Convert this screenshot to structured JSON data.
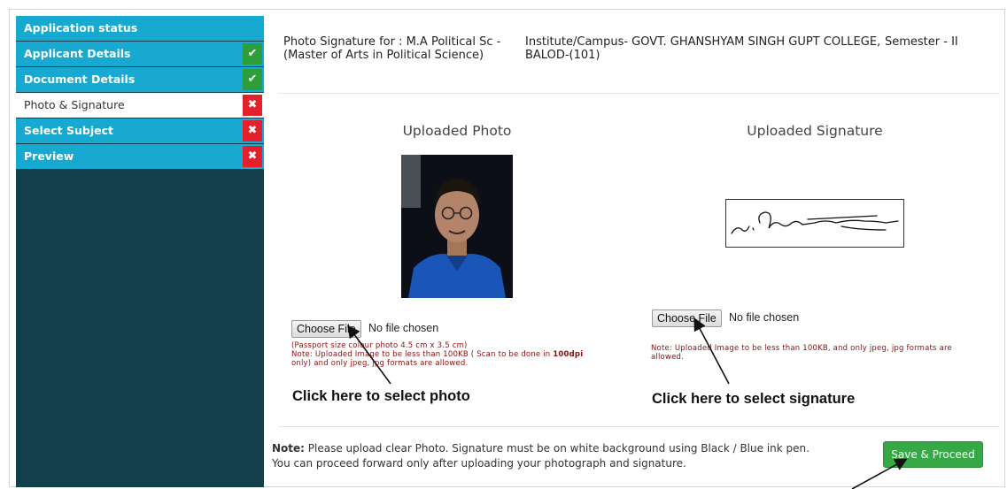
{
  "sidebar": {
    "items": [
      {
        "label": "Application status",
        "status": "none"
      },
      {
        "label": "Applicant Details",
        "status": "done",
        "badge": "✔"
      },
      {
        "label": "Document Details",
        "status": "done",
        "badge": "✔"
      },
      {
        "label": "Photo & Signature",
        "status": "pending",
        "badge": "✖"
      },
      {
        "label": "Select Subject",
        "status": "pending",
        "badge": "✖"
      },
      {
        "label": "Preview",
        "status": "pending",
        "badge": "✖"
      }
    ]
  },
  "header": {
    "course_line1": "Photo Signature for : M.A Political Sc -",
    "course_line2": "(Master of Arts in Political Science)",
    "institute_line1": "Institute/Campus- GOVT. GHANSHYAM SINGH GUPT COLLEGE,",
    "institute_line2": "BALOD-(101)",
    "semester": "Semester - II"
  },
  "photo": {
    "title": "Uploaded Photo",
    "choose_label": "Choose File",
    "no_file": "No file chosen",
    "note_line1": "(Passport size colour photo 4.5 cm x 3.5 cm)",
    "note_line2_a": "Note: Uploaded Image to be less than 100KB ( Scan to be done in ",
    "note_line2_b": "100dpi",
    "note_line3": "only) and only jpeg, jpg formats are allowed.",
    "callout": "Click here to select photo"
  },
  "signature": {
    "title": "Uploaded Signature",
    "choose_label": "Choose File",
    "no_file": "No file chosen",
    "note_line1": "Note: Uploaded Image to be less than 100KB, and only jpeg, jpg formats are",
    "note_line2": "allowed.",
    "callout": "Click here to select signature"
  },
  "footer": {
    "note_bold": "Note:",
    "note_line1": " Please upload clear Photo. Signature must be on white background using Black / Blue ink pen.",
    "note_line2": "You can proceed forward only after uploading your photograph and signature.",
    "save_label": "Save & Proceed"
  },
  "colors": {
    "sidebar_bg": "#123f4b",
    "sidebar_item": "#17a9cf",
    "ok": "#2e9e3b",
    "bad": "#e5202a",
    "save": "#36a845"
  }
}
